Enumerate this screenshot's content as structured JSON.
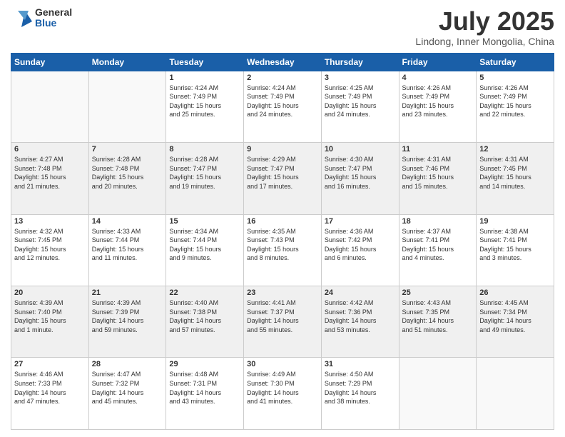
{
  "header": {
    "logo_general": "General",
    "logo_blue": "Blue",
    "month_title": "July 2025",
    "location": "Lindong, Inner Mongolia, China"
  },
  "weekdays": [
    "Sunday",
    "Monday",
    "Tuesday",
    "Wednesday",
    "Thursday",
    "Friday",
    "Saturday"
  ],
  "weeks": [
    [
      {
        "num": "",
        "info": ""
      },
      {
        "num": "",
        "info": ""
      },
      {
        "num": "1",
        "info": "Sunrise: 4:24 AM\nSunset: 7:49 PM\nDaylight: 15 hours\nand 25 minutes."
      },
      {
        "num": "2",
        "info": "Sunrise: 4:24 AM\nSunset: 7:49 PM\nDaylight: 15 hours\nand 24 minutes."
      },
      {
        "num": "3",
        "info": "Sunrise: 4:25 AM\nSunset: 7:49 PM\nDaylight: 15 hours\nand 24 minutes."
      },
      {
        "num": "4",
        "info": "Sunrise: 4:26 AM\nSunset: 7:49 PM\nDaylight: 15 hours\nand 23 minutes."
      },
      {
        "num": "5",
        "info": "Sunrise: 4:26 AM\nSunset: 7:49 PM\nDaylight: 15 hours\nand 22 minutes."
      }
    ],
    [
      {
        "num": "6",
        "info": "Sunrise: 4:27 AM\nSunset: 7:48 PM\nDaylight: 15 hours\nand 21 minutes."
      },
      {
        "num": "7",
        "info": "Sunrise: 4:28 AM\nSunset: 7:48 PM\nDaylight: 15 hours\nand 20 minutes."
      },
      {
        "num": "8",
        "info": "Sunrise: 4:28 AM\nSunset: 7:47 PM\nDaylight: 15 hours\nand 19 minutes."
      },
      {
        "num": "9",
        "info": "Sunrise: 4:29 AM\nSunset: 7:47 PM\nDaylight: 15 hours\nand 17 minutes."
      },
      {
        "num": "10",
        "info": "Sunrise: 4:30 AM\nSunset: 7:47 PM\nDaylight: 15 hours\nand 16 minutes."
      },
      {
        "num": "11",
        "info": "Sunrise: 4:31 AM\nSunset: 7:46 PM\nDaylight: 15 hours\nand 15 minutes."
      },
      {
        "num": "12",
        "info": "Sunrise: 4:31 AM\nSunset: 7:45 PM\nDaylight: 15 hours\nand 14 minutes."
      }
    ],
    [
      {
        "num": "13",
        "info": "Sunrise: 4:32 AM\nSunset: 7:45 PM\nDaylight: 15 hours\nand 12 minutes."
      },
      {
        "num": "14",
        "info": "Sunrise: 4:33 AM\nSunset: 7:44 PM\nDaylight: 15 hours\nand 11 minutes."
      },
      {
        "num": "15",
        "info": "Sunrise: 4:34 AM\nSunset: 7:44 PM\nDaylight: 15 hours\nand 9 minutes."
      },
      {
        "num": "16",
        "info": "Sunrise: 4:35 AM\nSunset: 7:43 PM\nDaylight: 15 hours\nand 8 minutes."
      },
      {
        "num": "17",
        "info": "Sunrise: 4:36 AM\nSunset: 7:42 PM\nDaylight: 15 hours\nand 6 minutes."
      },
      {
        "num": "18",
        "info": "Sunrise: 4:37 AM\nSunset: 7:41 PM\nDaylight: 15 hours\nand 4 minutes."
      },
      {
        "num": "19",
        "info": "Sunrise: 4:38 AM\nSunset: 7:41 PM\nDaylight: 15 hours\nand 3 minutes."
      }
    ],
    [
      {
        "num": "20",
        "info": "Sunrise: 4:39 AM\nSunset: 7:40 PM\nDaylight: 15 hours\nand 1 minute."
      },
      {
        "num": "21",
        "info": "Sunrise: 4:39 AM\nSunset: 7:39 PM\nDaylight: 14 hours\nand 59 minutes."
      },
      {
        "num": "22",
        "info": "Sunrise: 4:40 AM\nSunset: 7:38 PM\nDaylight: 14 hours\nand 57 minutes."
      },
      {
        "num": "23",
        "info": "Sunrise: 4:41 AM\nSunset: 7:37 PM\nDaylight: 14 hours\nand 55 minutes."
      },
      {
        "num": "24",
        "info": "Sunrise: 4:42 AM\nSunset: 7:36 PM\nDaylight: 14 hours\nand 53 minutes."
      },
      {
        "num": "25",
        "info": "Sunrise: 4:43 AM\nSunset: 7:35 PM\nDaylight: 14 hours\nand 51 minutes."
      },
      {
        "num": "26",
        "info": "Sunrise: 4:45 AM\nSunset: 7:34 PM\nDaylight: 14 hours\nand 49 minutes."
      }
    ],
    [
      {
        "num": "27",
        "info": "Sunrise: 4:46 AM\nSunset: 7:33 PM\nDaylight: 14 hours\nand 47 minutes."
      },
      {
        "num": "28",
        "info": "Sunrise: 4:47 AM\nSunset: 7:32 PM\nDaylight: 14 hours\nand 45 minutes."
      },
      {
        "num": "29",
        "info": "Sunrise: 4:48 AM\nSunset: 7:31 PM\nDaylight: 14 hours\nand 43 minutes."
      },
      {
        "num": "30",
        "info": "Sunrise: 4:49 AM\nSunset: 7:30 PM\nDaylight: 14 hours\nand 41 minutes."
      },
      {
        "num": "31",
        "info": "Sunrise: 4:50 AM\nSunset: 7:29 PM\nDaylight: 14 hours\nand 38 minutes."
      },
      {
        "num": "",
        "info": ""
      },
      {
        "num": "",
        "info": ""
      }
    ]
  ]
}
